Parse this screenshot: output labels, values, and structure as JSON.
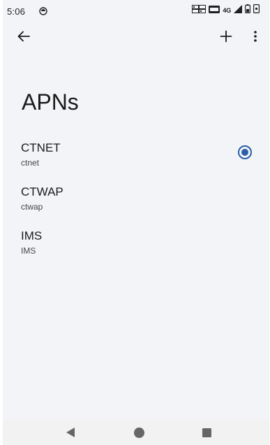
{
  "status_bar": {
    "time": "5:06",
    "network": "4G",
    "icons": [
      "notification-icon",
      "sim-card-icon",
      "signal-icon",
      "battery-icon",
      "screen-record-icon"
    ]
  },
  "app_bar": {
    "back_icon": "arrow-left-icon",
    "add_icon": "plus-icon",
    "more_icon": "more-vert-icon"
  },
  "page": {
    "title": "APNs"
  },
  "apns": [
    {
      "name": "CTNET",
      "apn": "ctnet",
      "selected": true
    },
    {
      "name": "CTWAP",
      "apn": "ctwap",
      "selected": false
    },
    {
      "name": "IMS",
      "apn": "IMS",
      "selected": false
    }
  ],
  "accent_color": "#2b5fa8",
  "nav_bar": {
    "icons": [
      "nav-back-icon",
      "nav-home-icon",
      "nav-recents-icon"
    ]
  }
}
